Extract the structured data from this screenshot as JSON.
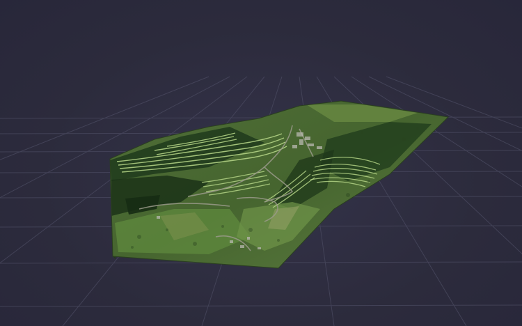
{
  "viewport": {
    "background_color": "#2c2b3c",
    "grid_color": "#4a4a60"
  },
  "terrain": {
    "description_icon": "terrain-mesh-icon",
    "base_color": "#4a6a32",
    "forest_color": "#1f3a1c",
    "field_color": "#7a9a4a",
    "contour_color": "#b9d98a",
    "road_color": "#9a9a8a"
  }
}
